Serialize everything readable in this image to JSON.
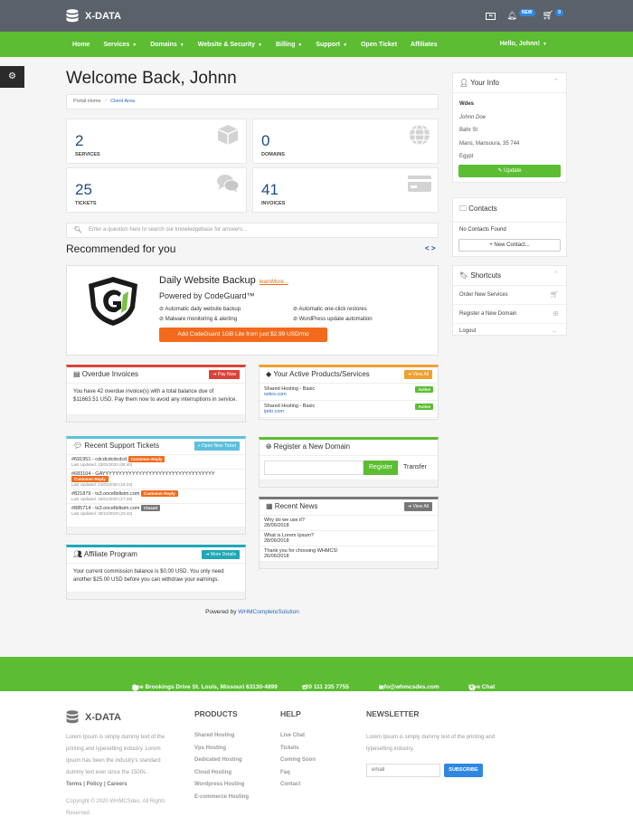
{
  "brand": {
    "name": "X-DATA"
  },
  "topbar": {
    "new_badge": "NEW",
    "cart_count": "0"
  },
  "nav": {
    "items": [
      {
        "label": "Home",
        "caret": false
      },
      {
        "label": "Services",
        "caret": true
      },
      {
        "label": "Domains",
        "caret": true
      },
      {
        "label": "Website & Security",
        "caret": true
      },
      {
        "label": "Billing",
        "caret": true
      },
      {
        "label": "Support",
        "caret": true
      },
      {
        "label": "Open Ticket",
        "caret": false
      },
      {
        "label": "Affiliates",
        "caret": false
      }
    ],
    "user": "Hello, Johnn!"
  },
  "page": {
    "title": "Welcome Back, Johnn",
    "breadcrumb": {
      "home": "Portal Home",
      "current": "Client Area"
    }
  },
  "stats": [
    {
      "value": "2",
      "label": "SERVICES",
      "icon": "box-icon"
    },
    {
      "value": "0",
      "label": "DOMAINS",
      "icon": "globe-icon"
    },
    {
      "value": "25",
      "label": "TICKETS",
      "icon": "comments-icon"
    },
    {
      "value": "41",
      "label": "INVOICES",
      "icon": "credit-card-icon"
    }
  ],
  "kb_search": {
    "placeholder": "Enter a question here to search our knowledgebase for answers..."
  },
  "recommended": {
    "heading": "Recommended for you",
    "title": "Daily Website Backup",
    "learn_more": "learnMore...",
    "subtitle": "Powered by CodeGuard™",
    "features": [
      "Automatic daily website backup",
      "Automatic one-click restores",
      "Malware monitoring & alerting",
      "WordPress update automation"
    ],
    "button": "Add CodeGuard 1GB Lite from just $2.99 USD/mo"
  },
  "overdue": {
    "title": "Overdue Invoices",
    "button": "Pay Now",
    "text": "You have 42 overdue invoice(s) with a total balance due of $11663.51 USD. Pay them now to avoid any interruptions in service."
  },
  "products": {
    "title": "Your Active Products/Services",
    "button": "View All",
    "items": [
      {
        "name": "Shared Hosting - Basic",
        "domain": "wdes.com",
        "status": "Active"
      },
      {
        "name": "Shared Hosting - Basic",
        "domain": "ijeto.com",
        "status": "Active"
      }
    ]
  },
  "tickets": {
    "title": "Recent Support Tickets",
    "button": "Open New Ticket",
    "items": [
      {
        "subject": "#691951 - cdcdcdcdcdcd",
        "status": "Customer-Reply",
        "updated": "Last Updated: 23/02/2020 (08:40)"
      },
      {
        "subject": "#683104 - GAYYYYYYYYYYYYYYYYYYYYYYYYYYYYYYYYYY",
        "status": "Customer-Reply",
        "updated": "Last Updated: 21/02/2020 (16:23)"
      },
      {
        "subject": "#821879 - ts3.oncelbilisim.com",
        "status": "Customer-Reply",
        "updated": "Last Updated: 16/01/2020 (17:28)"
      },
      {
        "subject": "#885714 - ts3.oncelbilisim.com",
        "status": "Closed",
        "updated": "Last Updated: 30/12/2019 (23:43)"
      }
    ]
  },
  "register_domain": {
    "title": "Register a New Domain",
    "register": "Register",
    "transfer": "Transfer"
  },
  "news": {
    "title": "Recent News",
    "button": "View All",
    "items": [
      {
        "title": "Why do we use it?",
        "date": "28/06/2018"
      },
      {
        "title": "What is Lorem Ipsum?",
        "date": "28/06/2018"
      },
      {
        "title": "Thank you for choosing WHMCS!",
        "date": "26/06/2018"
      }
    ]
  },
  "affiliate": {
    "title": "Affiliate Program",
    "button": "More Details",
    "text": "Your current commission balance is $0.00 USD. You only need another $25.00 USD before you can withdraw your earnings."
  },
  "powered": {
    "prefix": "Powered by ",
    "link": "WHMCompleteSolution"
  },
  "your_info": {
    "title": "Your Info",
    "company": "Wdes",
    "name": "Johnn Doe",
    "street": "Bahr St",
    "city": "Mans, Mansoura, 35 744",
    "country": "Egypt",
    "button": "Update"
  },
  "contacts": {
    "title": "Contacts",
    "empty": "No Contacts Found",
    "button": "New Contact..."
  },
  "shortcuts": {
    "title": "Shortcuts",
    "items": [
      {
        "label": "Order New Services",
        "icon": "cart-icon"
      },
      {
        "label": "Register a New Domain",
        "icon": "globe-icon"
      },
      {
        "label": "Logout",
        "icon": "arrow-left-icon"
      }
    ]
  },
  "contact_bar": {
    "address": "One Brookings Drive St. Louis, Missouri 63130-4899",
    "phone": "+20 111 235 7755",
    "email": "info@whmcsdes.com",
    "chat": "Live Chat"
  },
  "footer": {
    "about": "Lorem Ipsum is simply dummy text of the printing and typesetting industry. Lorem Ipsum has been the industry's standard dummy text ever since the 1500s .",
    "links": {
      "terms": "Terms",
      "policy": "Policy",
      "careers": "Careers"
    },
    "copyright": "Copyright © 2020 WHMCSdes. All Rights Reserved.",
    "products_heading": "PRODUCTS",
    "products": [
      "Shared Hosting",
      "Vps Hosting",
      "Dedicated Hosting",
      "Cloud Hosting",
      "Wordpress Hosting",
      "E-commerce Hosting"
    ],
    "help_heading": "HELP",
    "help": [
      "Live Chat",
      "Tickets",
      "Coming Soon",
      "Faq",
      "Contact"
    ],
    "newsletter_heading": "NEWSLETTER",
    "newsletter_text": "Lorem Ipsum is simply dummy text of the printing and typesetting industry.",
    "email_placeholder": "email",
    "subscribe": "SUBSCRIBE"
  },
  "colors": {
    "green": "#5cbd33",
    "topbar": "#5b616b",
    "orange": "#f26a1b",
    "navy": "#1f4d84"
  }
}
